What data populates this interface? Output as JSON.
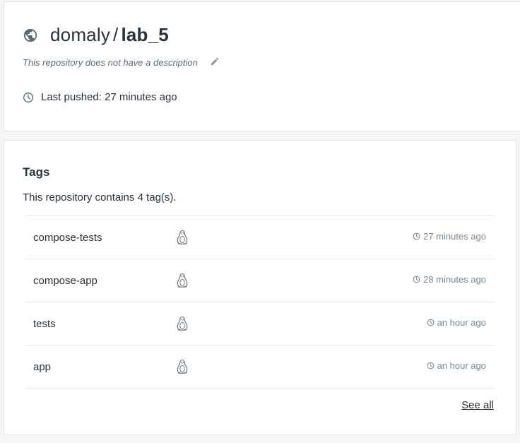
{
  "repository": {
    "namespace": "domaly",
    "separator": "/",
    "name": "lab_5",
    "description": "This repository does not have a description",
    "last_pushed": "Last pushed: 27 minutes ago"
  },
  "tags_section": {
    "heading": "Tags",
    "summary": "This repository contains 4 tag(s).",
    "rows": [
      {
        "name": "compose-tests",
        "os_icon": "linux-icon",
        "time": "27 minutes ago"
      },
      {
        "name": "compose-app",
        "os_icon": "linux-icon",
        "time": "28 minutes ago"
      },
      {
        "name": "tests",
        "os_icon": "linux-icon",
        "time": "an hour ago"
      },
      {
        "name": "app",
        "os_icon": "linux-icon",
        "time": "an hour ago"
      }
    ],
    "see_all": "See all"
  },
  "icons": {
    "globe": "globe-icon",
    "edit": "pencil-icon",
    "clock": "clock-icon"
  },
  "colors": {
    "text": "#27313a",
    "muted": "#788896",
    "border": "#dfe3e6",
    "background": "#f4f6f7"
  }
}
